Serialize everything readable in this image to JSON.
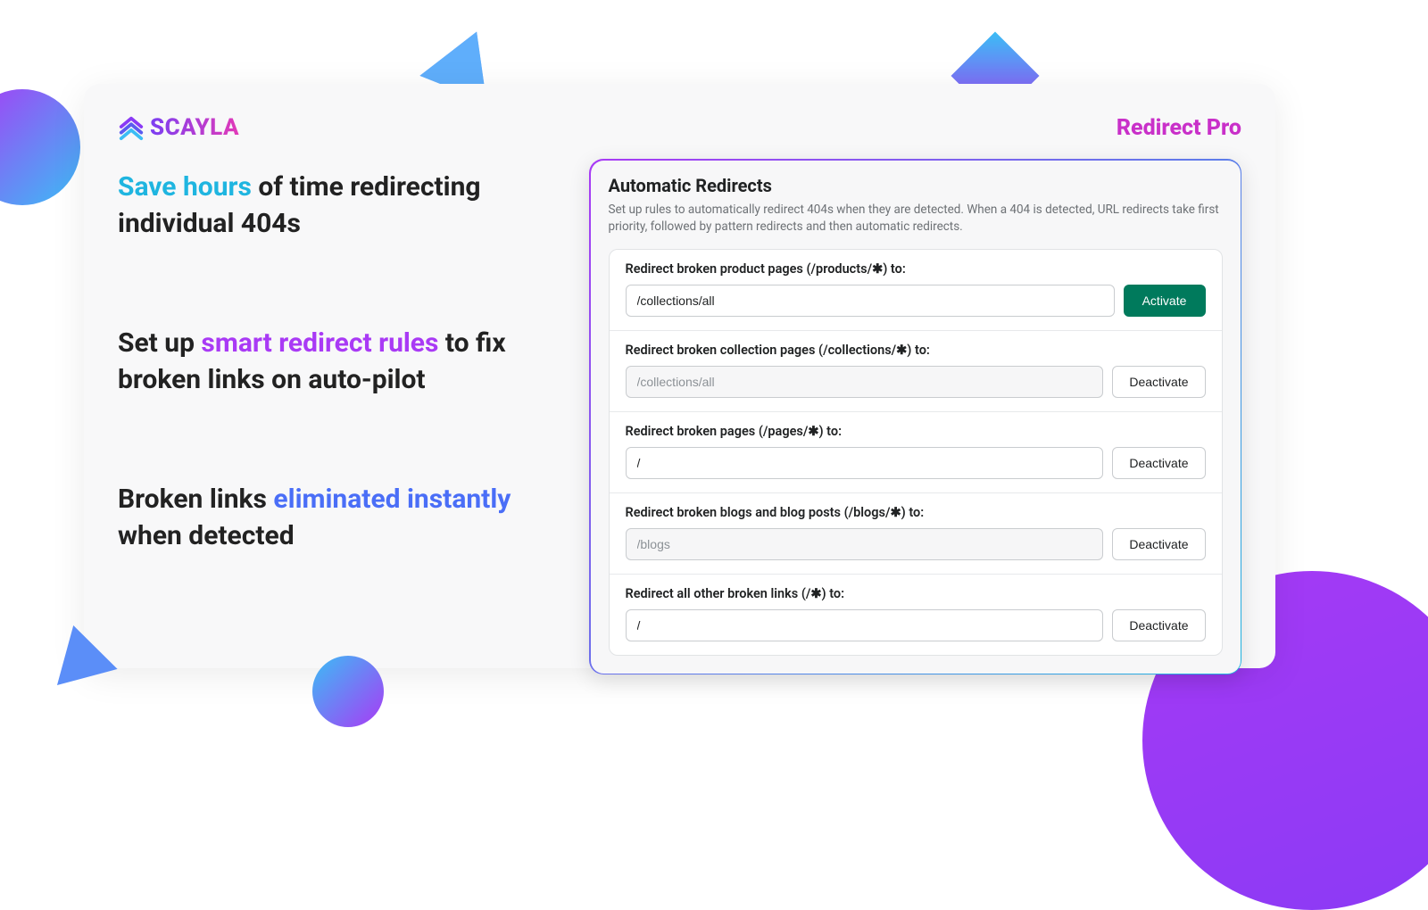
{
  "brand": {
    "name": "SCAYLA"
  },
  "product_name": "Redirect Pro",
  "bullets": {
    "b1": {
      "hl": "Save hours",
      "rest": " of time redirecting individual 404s"
    },
    "b2": {
      "pre": "Set up ",
      "hl": "smart redirect rules",
      "post": " to fix broken links on auto-pilot"
    },
    "b3": {
      "pre": "Broken links ",
      "hl": "eliminated instantly",
      "post": " when detected"
    }
  },
  "panel": {
    "title": "Automatic Redirects",
    "description": "Set up rules to automatically redirect 404s when they are detected. When a 404 is detected, URL redirects take first priority, followed by pattern redirects and then automatic redirects."
  },
  "rules": [
    {
      "label": "Redirect broken product pages (/products/✱) to:",
      "value": "/collections/all",
      "button": "Activate",
      "primary": true,
      "disabled": false
    },
    {
      "label": "Redirect broken collection pages (/collections/✱) to:",
      "value": "/collections/all",
      "button": "Deactivate",
      "primary": false,
      "disabled": true
    },
    {
      "label": "Redirect broken pages (/pages/✱) to:",
      "value": "/",
      "button": "Deactivate",
      "primary": false,
      "disabled": false
    },
    {
      "label": "Redirect broken blogs and blog posts (/blogs/✱) to:",
      "value": "/blogs",
      "button": "Deactivate",
      "primary": false,
      "disabled": true
    },
    {
      "label": "Redirect all other broken links (/✱) to:",
      "value": "/",
      "button": "Deactivate",
      "primary": false,
      "disabled": false
    }
  ]
}
